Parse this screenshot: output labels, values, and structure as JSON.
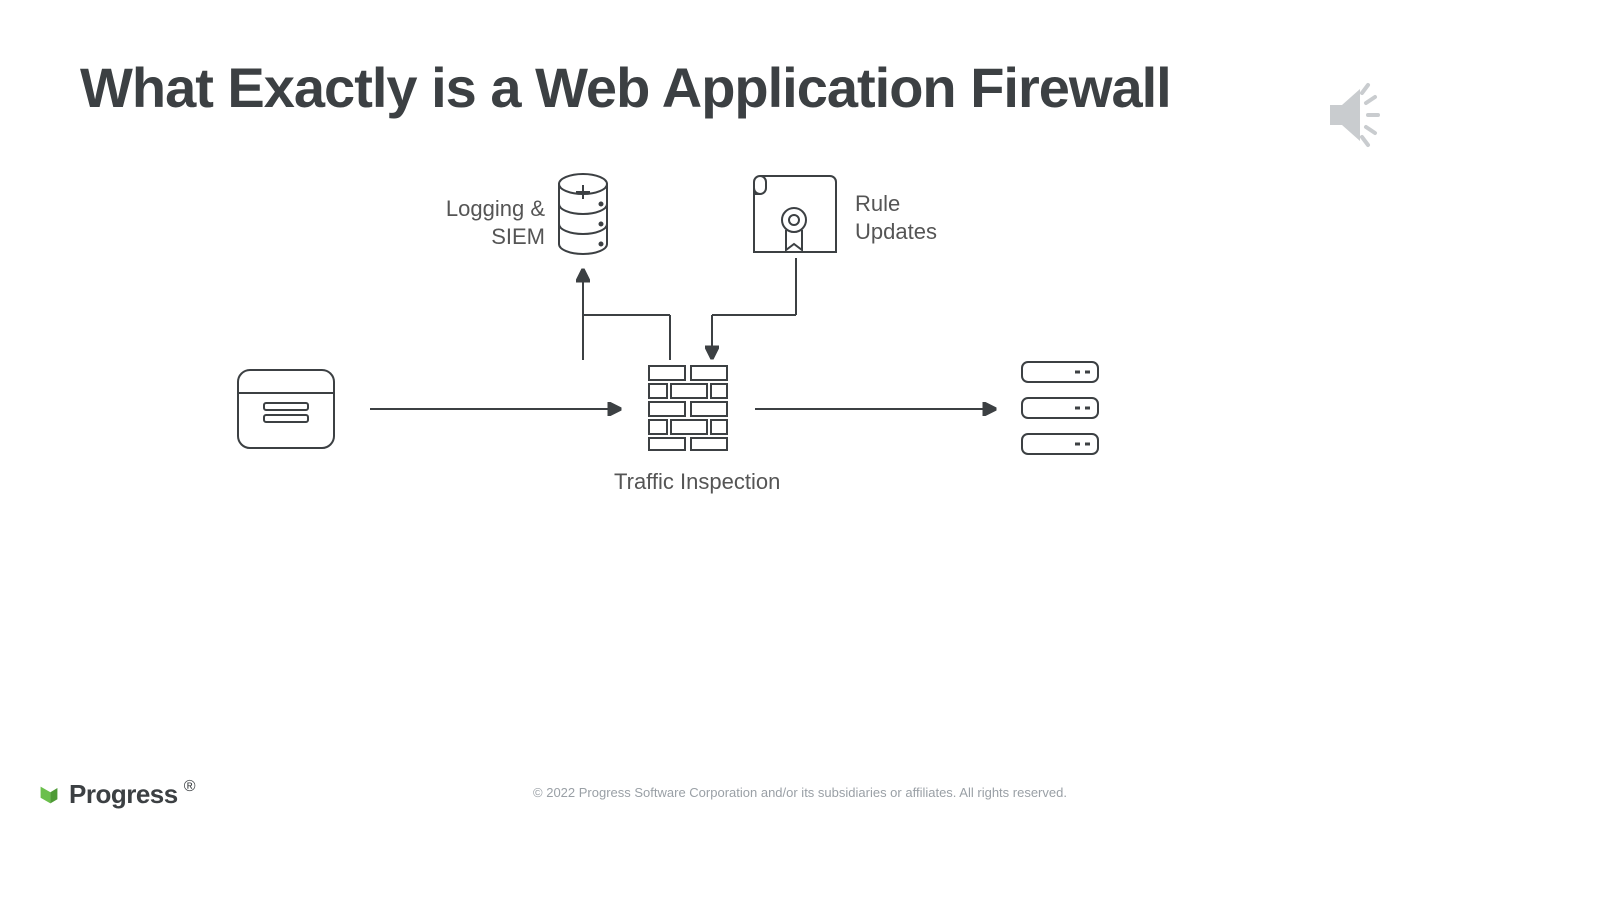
{
  "title": "What Exactly is a Web Application Firewall",
  "labels": {
    "logging": "Logging &\nSIEM",
    "rule": "Rule\nUpdates",
    "traffic": "Traffic Inspection"
  },
  "footer": {
    "copyright": "© 2022 Progress Software Corporation and/or its subsidiaries or affiliates. All rights reserved.",
    "brand": "Progress"
  }
}
